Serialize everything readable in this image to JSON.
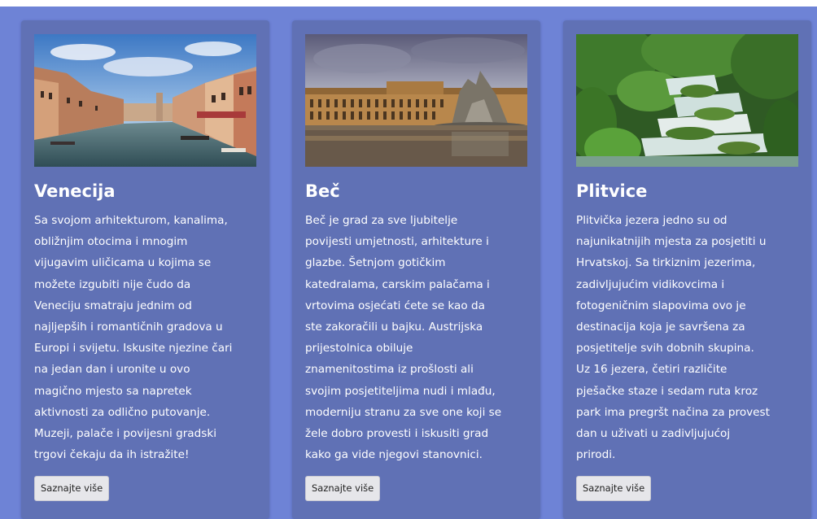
{
  "cards": [
    {
      "title": "Venecija",
      "text": "Sa svojom arhitekturom, kanalima,\nobližnjim otocima i mnogim\nvijugavim uličicama u kojima se\nmožete izgubiti nije čudo da\nVeneciju smatraju jednim od\nnajljepših i romantičnih gradova u\nEuropi i svijetu. Iskusite njezine čari\nna jedan dan i uronite u ovo\nmagično mjesto sa napretek\naktivnosti za odlično putovanje.\nMuzeji, palače i povijesni gradski\ntrgovi čekaju da ih istražite!",
      "button": "Saznajte više"
    },
    {
      "title": "Beč",
      "text": "Beč je grad za sve ljubitelje\npovijesti umjetnosti, arhitekture i\nglazbe. Šetnjom gotičkim\nkatedralama, carskim palačama i\nvrtovima osjećati ćete se kao da\nste zakoračili u bajku. Austrijska\nprijestolnica obiluje\nznamenitostima iz prošlosti ali\nsvojim posjetiteljima nudi i mlađu,\nmoderniju stranu za sve one koji se\nžele dobro provesti i iskusiti grad\nkako ga vide njegovi stanovnici.",
      "button": "Saznajte više"
    },
    {
      "title": "Plitvice",
      "text": "Plitvička jezera jedno su od\nnajunikatnijih mjesta za posjetiti u\nHrvatskoj. Sa tirkiznim jezerima,\nzadivljujućim vidikovcima i\nfotogeničnim slapovima ovo je\ndestinacija koja je savršena za\nposjetitelje svih dobnih skupina.\nUz 16 jezera, četiri različite\npješačke staze i sedam ruta kroz\npark ima pregršt načina za provest\ndan u uživati u zadivljujućoj\nprirodi.",
      "button": "Saznajte više"
    }
  ],
  "colors": {
    "section_bg": "#6e83d6",
    "card_bg": "#6071b5",
    "button_bg": "#e6e6ea"
  }
}
